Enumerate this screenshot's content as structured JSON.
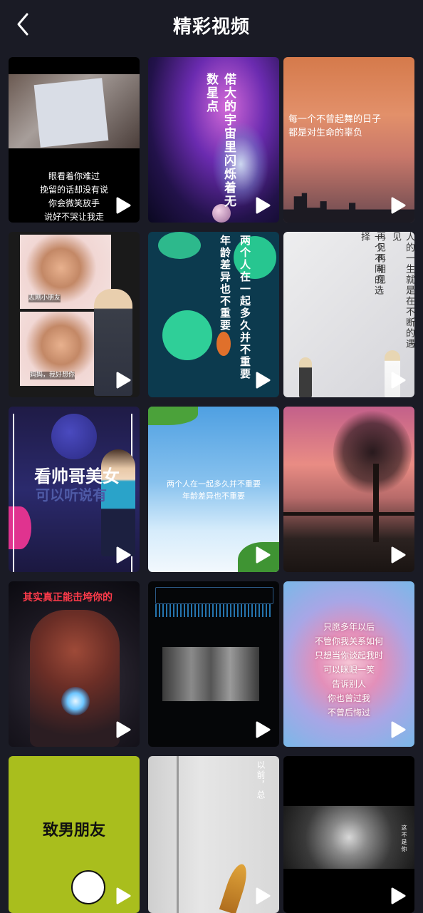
{
  "header": {
    "title": "精彩视频",
    "back_icon": "chevron-left-icon"
  },
  "colors": {
    "background": "#1a1b25",
    "text": "#ffffff",
    "play_icon": "#ffffff"
  },
  "play_icon": "play-icon",
  "videos": [
    {
      "caption_lines": [
        "眼看着你难过",
        "挽留的话却没有说",
        "你会微笑放手",
        "说好不哭让我走"
      ]
    },
    {
      "caption": "偌大的宇宙里闪烁着无数星点"
    },
    {
      "caption_lines": [
        "每一个不曾起舞的日子",
        "都是对生命的辜负"
      ]
    },
    {
      "caption_lines": [
        "志刚小朋友",
        "妈妈，我好想你"
      ]
    },
    {
      "caption_col1": "两个人在一起多久并不重要",
      "caption_col2": "年龄差异也不重要"
    },
    {
      "caption_col1": "人的一生就是在不断的遇见",
      "caption_col2": "再见再相见",
      "caption_col3": "一个不同的选择"
    },
    {
      "caption_lines": [
        "看帅哥美女",
        "可以听说有"
      ]
    },
    {
      "caption_lines": [
        "两个人在一起多久并不重要",
        "年龄差异也不重要"
      ]
    },
    {
      "caption": ""
    },
    {
      "caption": "其实真正能击垮你的"
    },
    {
      "caption": ""
    },
    {
      "caption_lines": [
        "只愿多年以后",
        "不管你我关系如何",
        "只想当你谈起我时",
        "可以眯眼一笑",
        "告诉别人",
        "你也曾过我",
        "不曾后悔过"
      ]
    },
    {
      "caption": "致男朋友"
    },
    {
      "caption_lines": [
        "以前，总"
      ]
    },
    {
      "caption": "这不是你"
    }
  ]
}
